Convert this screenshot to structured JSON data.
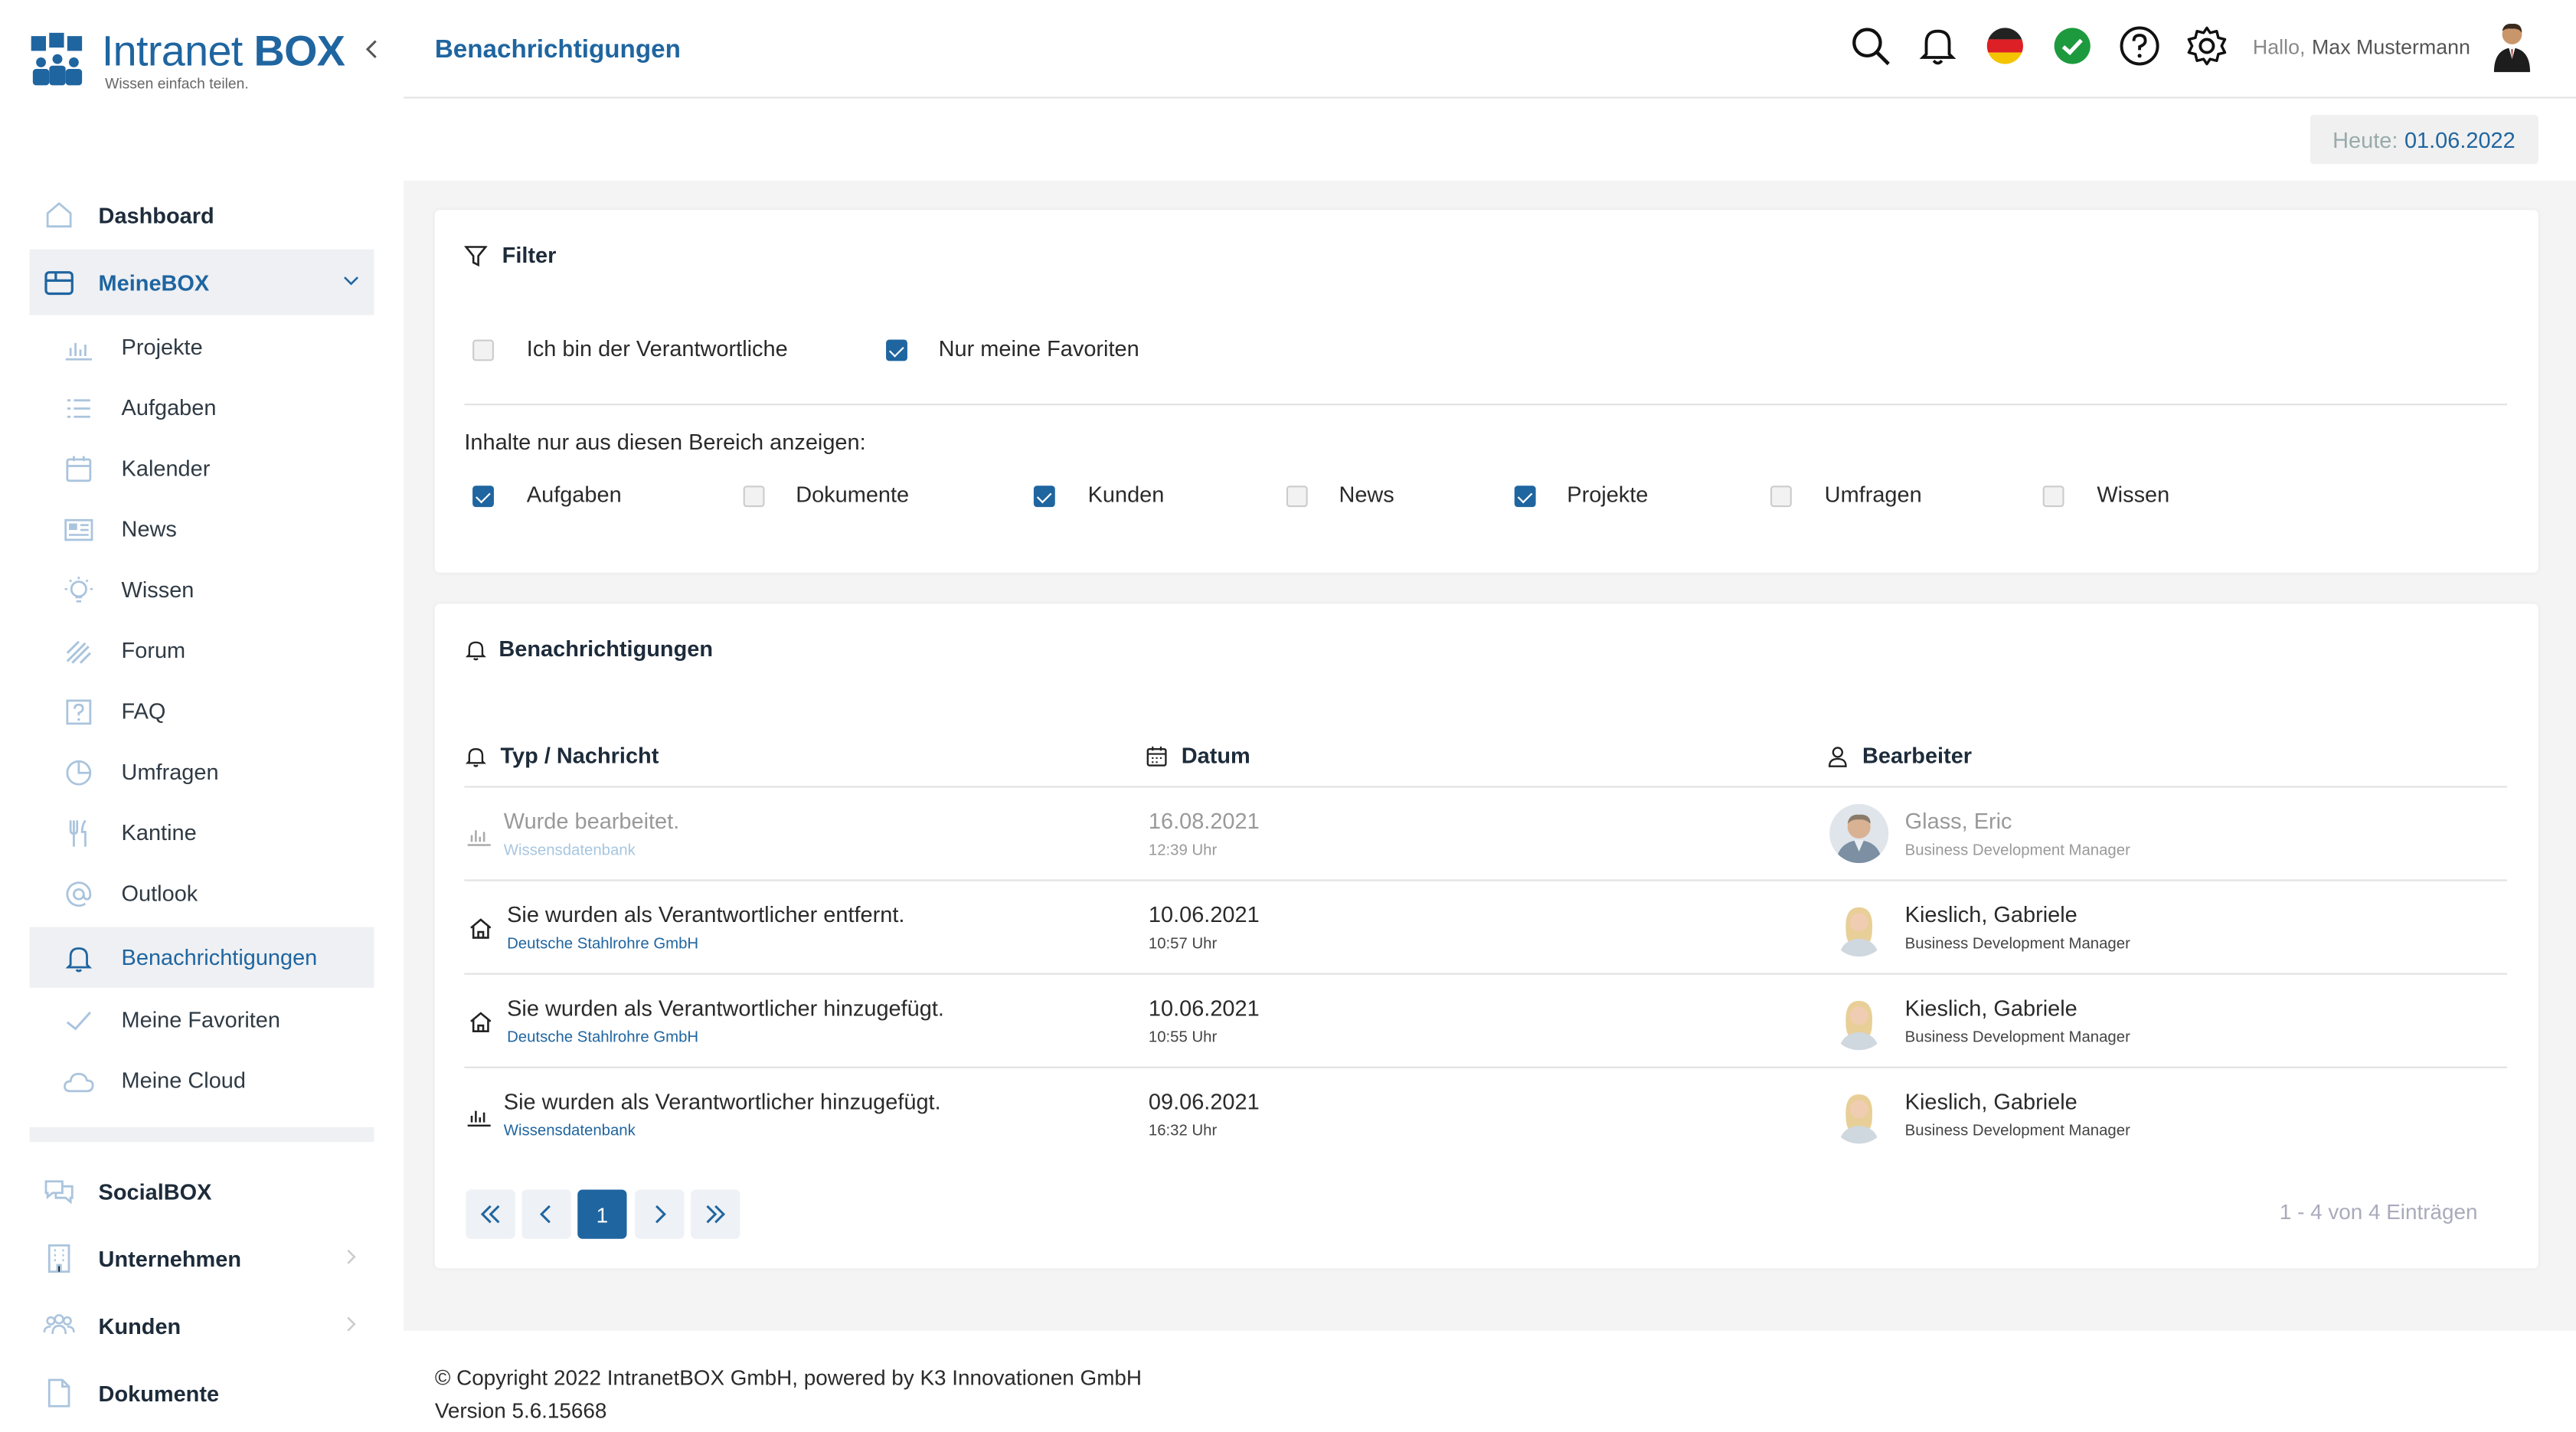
{
  "brand": {
    "title_main": "Intranet",
    "title_bold": "BOX",
    "tagline": "Wissen einfach teilen.",
    "accent_color": "#1f65a0"
  },
  "sidebar": {
    "top_items": [
      {
        "label": "Dashboard",
        "icon": "home-icon"
      },
      {
        "label": "MeineBOX",
        "icon": "box-icon"
      }
    ],
    "sub_items": [
      {
        "label": "Projekte",
        "icon": "bar-chart-icon"
      },
      {
        "label": "Aufgaben",
        "icon": "list-icon"
      },
      {
        "label": "Kalender",
        "icon": "calendar-icon"
      },
      {
        "label": "News",
        "icon": "newspaper-icon"
      },
      {
        "label": "Wissen",
        "icon": "lightbulb-icon"
      },
      {
        "label": "Forum",
        "icon": "forum-icon"
      },
      {
        "label": "FAQ",
        "icon": "question-icon"
      },
      {
        "label": "Umfragen",
        "icon": "pie-chart-icon"
      },
      {
        "label": "Kantine",
        "icon": "cutlery-icon"
      },
      {
        "label": "Outlook",
        "icon": "at-icon"
      },
      {
        "label": "Benachrichtigungen",
        "icon": "bell-icon"
      },
      {
        "label": "Meine Favoriten",
        "icon": "check-icon"
      },
      {
        "label": "Meine Cloud",
        "icon": "cloud-icon"
      }
    ],
    "bottom_items": [
      {
        "label": "SocialBOX",
        "icon": "chat-icon"
      },
      {
        "label": "Unternehmen",
        "icon": "building-icon"
      },
      {
        "label": "Kunden",
        "icon": "people-icon"
      },
      {
        "label": "Dokumente",
        "icon": "document-icon"
      }
    ]
  },
  "header": {
    "page_title": "Benachrichtigungen",
    "greeting": "Hallo,",
    "user_name": "Max Mustermann"
  },
  "today": {
    "label": "Heute:",
    "value": "01.06.2022"
  },
  "filter": {
    "title": "Filter",
    "options": [
      {
        "label": "Ich bin der Verantwortliche",
        "checked": false
      },
      {
        "label": "Nur meine Favoriten",
        "checked": true
      }
    ],
    "areas_label": "Inhalte nur aus diesen Bereich anzeigen:",
    "areas": [
      {
        "label": "Aufgaben",
        "checked": true
      },
      {
        "label": "Dokumente",
        "checked": false
      },
      {
        "label": "Kunden",
        "checked": true
      },
      {
        "label": "News",
        "checked": false
      },
      {
        "label": "Projekte",
        "checked": true
      },
      {
        "label": "Umfragen",
        "checked": false
      },
      {
        "label": "Wissen",
        "checked": false
      }
    ]
  },
  "notifications": {
    "title": "Benachrichtigungen",
    "columns": [
      "Typ / Nachricht",
      "Datum",
      "Bearbeiter"
    ],
    "rows": [
      {
        "message": "Wurde bearbeitet.",
        "source": "Wissensdatenbank",
        "date": "16.08.2021",
        "time": "12:39 Uhr",
        "person": "Glass, Eric",
        "role": "Business Development Manager",
        "icon": "bar-chart-icon",
        "read": true
      },
      {
        "message": "Sie wurden als Verantwortlicher entfernt.",
        "source": "Deutsche Stahlrohre GmbH",
        "date": "10.06.2021",
        "time": "10:57 Uhr",
        "person": "Kieslich, Gabriele",
        "role": "Business Development Manager",
        "icon": "home-icon",
        "read": false
      },
      {
        "message": "Sie wurden als Verantwortlicher hinzugefügt.",
        "source": "Deutsche Stahlrohre GmbH",
        "date": "10.06.2021",
        "time": "10:55 Uhr",
        "person": "Kieslich, Gabriele",
        "role": "Business Development Manager",
        "icon": "home-icon",
        "read": false
      },
      {
        "message": "Sie wurden als Verantwortlicher hinzugefügt.",
        "source": "Wissensdatenbank",
        "date": "09.06.2021",
        "time": "16:32 Uhr",
        "person": "Kieslich, Gabriele",
        "role": "Business Development Manager",
        "icon": "bar-chart-icon",
        "read": false
      }
    ],
    "pagination": {
      "current": "1",
      "summary": "1 - 4 von 4 Einträgen"
    }
  },
  "footer": {
    "copyright": "© Copyright 2022 IntranetBOX GmbH, powered by K3 Innovationen GmbH",
    "version": "Version 5.6.15668"
  }
}
